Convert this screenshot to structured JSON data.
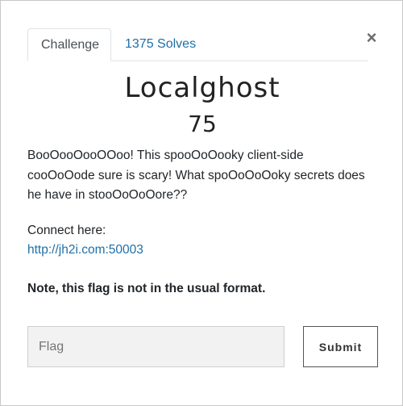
{
  "tabs": {
    "challenge_label": "Challenge",
    "solves_label": "1375 Solves"
  },
  "close_symbol": "×",
  "challenge": {
    "name": "Localghost",
    "points": "75",
    "description": "BooOooOooOOoo! This spooOoOooky client-side cooOoOode sure is scary! What spoOoOoOoky secrets does he have in stooOoOoOore??",
    "connect_label": "Connect here:",
    "connect_url": "http://jh2i.com:50003",
    "note": "Note, this flag is not in the usual format."
  },
  "form": {
    "flag_placeholder": "Flag",
    "flag_value": "",
    "submit_label": "Submit"
  },
  "colors": {
    "link": "#1f6fa8",
    "text": "#212529",
    "input_bg": "#f2f2f2"
  }
}
